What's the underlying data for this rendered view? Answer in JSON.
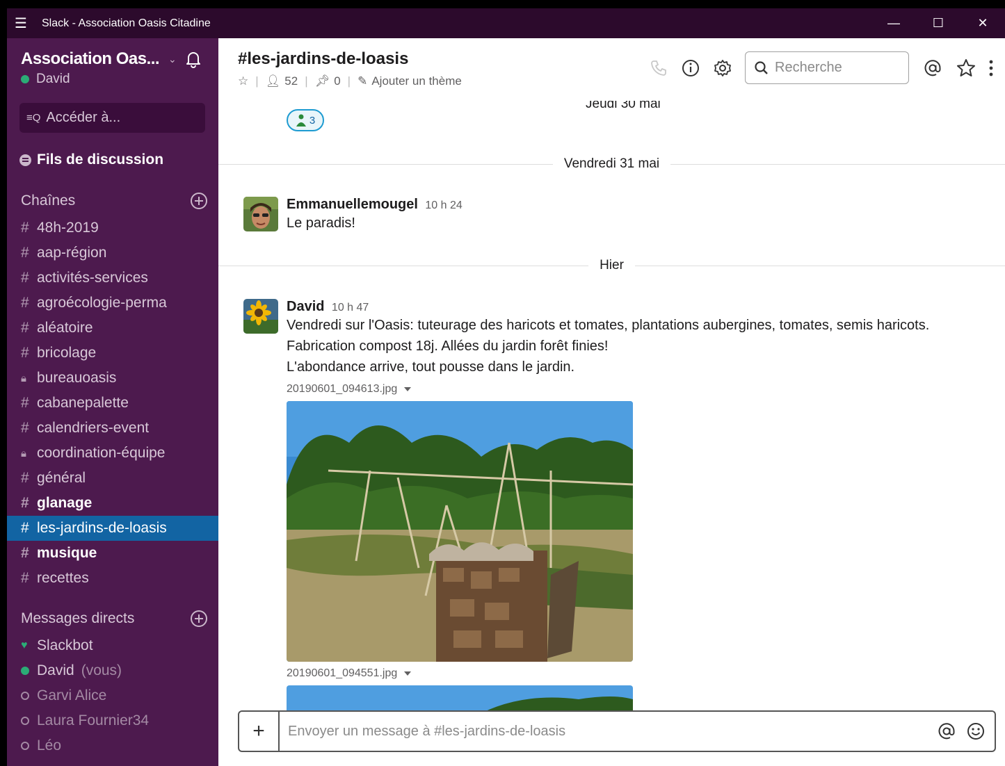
{
  "window": {
    "title": "Slack - Association Oasis Citadine"
  },
  "workspace": {
    "name": "Association Oas...",
    "user": "David"
  },
  "sidebar": {
    "jump_label": "Accéder à...",
    "threads_label": "Fils de discussion",
    "channels_label": "Chaînes",
    "channels": [
      {
        "name": "48h-2019",
        "type": "public",
        "bold": false,
        "active": false
      },
      {
        "name": "aap-région",
        "type": "public",
        "bold": false,
        "active": false
      },
      {
        "name": "activités-services",
        "type": "public",
        "bold": false,
        "active": false
      },
      {
        "name": "agroécologie-perma",
        "type": "public",
        "bold": false,
        "active": false
      },
      {
        "name": "aléatoire",
        "type": "public",
        "bold": false,
        "active": false
      },
      {
        "name": "bricolage",
        "type": "public",
        "bold": false,
        "active": false
      },
      {
        "name": "bureauoasis",
        "type": "private",
        "bold": false,
        "active": false
      },
      {
        "name": "cabanepalette",
        "type": "public",
        "bold": false,
        "active": false
      },
      {
        "name": "calendriers-event",
        "type": "public",
        "bold": false,
        "active": false
      },
      {
        "name": "coordination-équipe",
        "type": "private",
        "bold": false,
        "active": false
      },
      {
        "name": "général",
        "type": "public",
        "bold": false,
        "active": false
      },
      {
        "name": "glanage",
        "type": "public",
        "bold": true,
        "active": false
      },
      {
        "name": "les-jardins-de-loasis",
        "type": "public",
        "bold": false,
        "active": true
      },
      {
        "name": "musique",
        "type": "public",
        "bold": true,
        "active": false
      },
      {
        "name": "recettes",
        "type": "public",
        "bold": false,
        "active": false
      }
    ],
    "dm_label": "Messages directs",
    "dms": [
      {
        "name": "Slackbot",
        "status": "bot",
        "you": ""
      },
      {
        "name": "David",
        "status": "online",
        "you": "(vous)"
      },
      {
        "name": "Garvi Alice",
        "status": "offline",
        "you": ""
      },
      {
        "name": "Laura Fournier34",
        "status": "offline",
        "you": ""
      },
      {
        "name": "Léo",
        "status": "offline",
        "you": ""
      }
    ]
  },
  "channel": {
    "title": "#les-jardins-de-loasis",
    "members": "52",
    "pins": "0",
    "add_topic": "Ajouter un thème",
    "search_placeholder": "Recherche"
  },
  "feed": {
    "floating_date": "Jeudi 30 mai",
    "reaction_count": "3",
    "dividers": [
      "Vendredi 31 mai",
      "Hier"
    ],
    "messages": [
      {
        "author": "Emmanuellemougel",
        "time": "10 h 24",
        "lines": [
          "Le paradis!"
        ]
      },
      {
        "author": "David",
        "time": "10 h 47",
        "lines": [
          "Vendredi sur l'Oasis: tuteurage des haricots et tomates, plantations aubergines, tomates, semis haricots.",
          "Fabrication compost 18j. Allées du jardin forêt finies!",
          "L'abondance arrive, tout pousse dans le jardin."
        ],
        "files": [
          "20190601_094613.jpg",
          "20190601_094551.jpg"
        ]
      }
    ]
  },
  "composer": {
    "placeholder": "Envoyer un message à #les-jardins-de-loasis"
  }
}
